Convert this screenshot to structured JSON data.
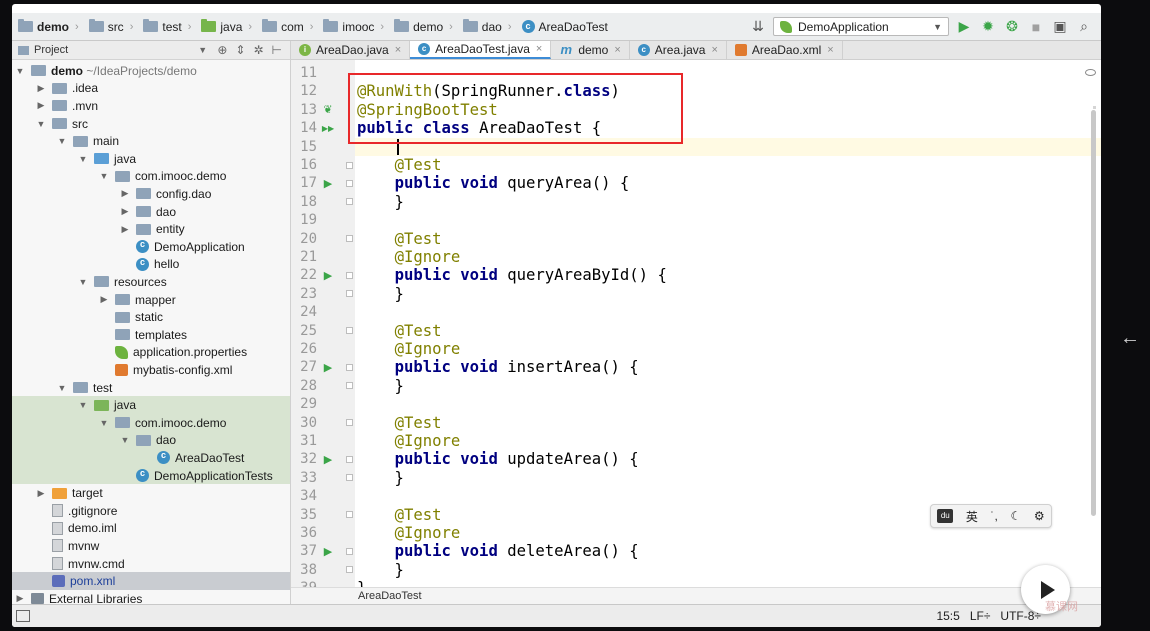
{
  "navbar": {
    "crumbs": [
      {
        "label": "demo",
        "icon": "folder-icon"
      },
      {
        "label": "src",
        "icon": "folder-icon"
      },
      {
        "label": "test",
        "icon": "folder-icon"
      },
      {
        "label": "java",
        "icon": "folder-green-icon"
      },
      {
        "label": "com",
        "icon": "package-icon"
      },
      {
        "label": "imooc",
        "icon": "package-icon"
      },
      {
        "label": "demo",
        "icon": "package-icon"
      },
      {
        "label": "dao",
        "icon": "package-icon"
      },
      {
        "label": "AreaDaoTest",
        "icon": "class-icon"
      }
    ],
    "run_config": "DemoApplication"
  },
  "project_panel": {
    "title": "Project",
    "tree": [
      {
        "label": "demo",
        "suffix": " ~/IdeaProjects/demo",
        "depth": 0,
        "arrow": "▼",
        "icon": "folder"
      },
      {
        "label": ".idea",
        "depth": 1,
        "arrow": "▶",
        "icon": "folder"
      },
      {
        "label": ".mvn",
        "depth": 1,
        "arrow": "▶",
        "icon": "folder"
      },
      {
        "label": "src",
        "depth": 1,
        "arrow": "▼",
        "icon": "folder"
      },
      {
        "label": "main",
        "depth": 2,
        "arrow": "▼",
        "icon": "folder"
      },
      {
        "label": "java",
        "depth": 3,
        "arrow": "▼",
        "icon": "folder-blue"
      },
      {
        "label": "com.imooc.demo",
        "depth": 4,
        "arrow": "▼",
        "icon": "pkg"
      },
      {
        "label": "config.dao",
        "depth": 5,
        "arrow": "▶",
        "icon": "pkg"
      },
      {
        "label": "dao",
        "depth": 5,
        "arrow": "▶",
        "icon": "pkg"
      },
      {
        "label": "entity",
        "depth": 5,
        "arrow": "▶",
        "icon": "pkg"
      },
      {
        "label": "DemoApplication",
        "depth": 5,
        "arrow": "",
        "icon": "cls"
      },
      {
        "label": "hello",
        "depth": 5,
        "arrow": "",
        "icon": "cls"
      },
      {
        "label": "resources",
        "depth": 3,
        "arrow": "▼",
        "icon": "folder-res"
      },
      {
        "label": "mapper",
        "depth": 4,
        "arrow": "▶",
        "icon": "folder"
      },
      {
        "label": "static",
        "depth": 4,
        "arrow": "",
        "icon": "folder"
      },
      {
        "label": "templates",
        "depth": 4,
        "arrow": "",
        "icon": "folder"
      },
      {
        "label": "application.properties",
        "depth": 4,
        "arrow": "",
        "icon": "props"
      },
      {
        "label": "mybatis-config.xml",
        "depth": 4,
        "arrow": "",
        "icon": "xml"
      },
      {
        "label": "test",
        "depth": 2,
        "arrow": "▼",
        "icon": "folder"
      },
      {
        "label": "java",
        "depth": 3,
        "arrow": "▼",
        "icon": "folder-green",
        "sel": true
      },
      {
        "label": "com.imooc.demo",
        "depth": 4,
        "arrow": "▼",
        "icon": "pkg",
        "sel": true
      },
      {
        "label": "dao",
        "depth": 5,
        "arrow": "▼",
        "icon": "pkg",
        "sel": true
      },
      {
        "label": "AreaDaoTest",
        "depth": 6,
        "arrow": "",
        "icon": "cls",
        "sel": true
      },
      {
        "label": "DemoApplicationTests",
        "depth": 5,
        "arrow": "",
        "icon": "cls",
        "sel": true
      },
      {
        "label": "target",
        "depth": 1,
        "arrow": "▶",
        "icon": "folder-orange"
      },
      {
        "label": ".gitignore",
        "depth": 1,
        "arrow": "",
        "icon": "file"
      },
      {
        "label": "demo.iml",
        "depth": 1,
        "arrow": "",
        "icon": "file"
      },
      {
        "label": "mvnw",
        "depth": 1,
        "arrow": "",
        "icon": "file"
      },
      {
        "label": "mvnw.cmd",
        "depth": 1,
        "arrow": "",
        "icon": "file"
      },
      {
        "label": "pom.xml",
        "depth": 1,
        "arrow": "",
        "icon": "pom",
        "hl": true
      },
      {
        "label": "External Libraries",
        "depth": 0,
        "arrow": "▶",
        "icon": "lib"
      }
    ]
  },
  "tabs": [
    {
      "label": "AreaDao.java",
      "icon": "i",
      "active": false
    },
    {
      "label": "AreaDaoTest.java",
      "icon": "c",
      "active": true
    },
    {
      "label": "demo",
      "icon": "m",
      "active": false
    },
    {
      "label": "Area.java",
      "icon": "c",
      "active": false
    },
    {
      "label": "AreaDao.xml",
      "icon": "x",
      "active": false
    }
  ],
  "editor": {
    "lines": [
      {
        "n": "11",
        "tokens": []
      },
      {
        "n": "12",
        "tokens": [
          [
            "ann",
            "@RunWith"
          ],
          [
            "",
            "(SpringRunner."
          ],
          [
            "kw",
            "class"
          ],
          [
            "",
            ")"
          ]
        ]
      },
      {
        "n": "13",
        "tokens": [
          [
            "ann",
            "@SpringBootTest"
          ]
        ],
        "gutter": "leaf"
      },
      {
        "n": "14",
        "tokens": [
          [
            "kw",
            "public class "
          ],
          [
            "",
            "AreaDaoTest {"
          ]
        ],
        "gutter": "run2"
      },
      {
        "n": "15",
        "tokens": [],
        "cur": true
      },
      {
        "n": "16",
        "tokens": [
          [
            "",
            "    "
          ],
          [
            "ann",
            "@Test"
          ]
        ],
        "fold": true
      },
      {
        "n": "17",
        "tokens": [
          [
            "",
            "    "
          ],
          [
            "kw",
            "public void "
          ],
          [
            "",
            "queryArea() {"
          ]
        ],
        "gutter": "run"
      },
      {
        "n": "18",
        "tokens": [
          [
            "",
            "    }"
          ]
        ],
        "fold": true
      },
      {
        "n": "19",
        "tokens": []
      },
      {
        "n": "20",
        "tokens": [
          [
            "",
            "    "
          ],
          [
            "ann",
            "@Test"
          ]
        ],
        "fold": true
      },
      {
        "n": "21",
        "tokens": [
          [
            "",
            "    "
          ],
          [
            "ann",
            "@Ignore"
          ]
        ]
      },
      {
        "n": "22",
        "tokens": [
          [
            "",
            "    "
          ],
          [
            "kw",
            "public void "
          ],
          [
            "",
            "queryAreaById() {"
          ]
        ],
        "gutter": "run"
      },
      {
        "n": "23",
        "tokens": [
          [
            "",
            "    }"
          ]
        ],
        "fold": true
      },
      {
        "n": "24",
        "tokens": []
      },
      {
        "n": "25",
        "tokens": [
          [
            "",
            "    "
          ],
          [
            "ann",
            "@Test"
          ]
        ],
        "fold": true
      },
      {
        "n": "26",
        "tokens": [
          [
            "",
            "    "
          ],
          [
            "ann",
            "@Ignore"
          ]
        ]
      },
      {
        "n": "27",
        "tokens": [
          [
            "",
            "    "
          ],
          [
            "kw",
            "public void "
          ],
          [
            "",
            "insertArea() {"
          ]
        ],
        "gutter": "run"
      },
      {
        "n": "28",
        "tokens": [
          [
            "",
            "    }"
          ]
        ],
        "fold": true
      },
      {
        "n": "29",
        "tokens": []
      },
      {
        "n": "30",
        "tokens": [
          [
            "",
            "    "
          ],
          [
            "ann",
            "@Test"
          ]
        ],
        "fold": true
      },
      {
        "n": "31",
        "tokens": [
          [
            "",
            "    "
          ],
          [
            "ann",
            "@Ignore"
          ]
        ]
      },
      {
        "n": "32",
        "tokens": [
          [
            "",
            "    "
          ],
          [
            "kw",
            "public void "
          ],
          [
            "",
            "updateArea() {"
          ]
        ],
        "gutter": "run"
      },
      {
        "n": "33",
        "tokens": [
          [
            "",
            "    }"
          ]
        ],
        "fold": true
      },
      {
        "n": "34",
        "tokens": []
      },
      {
        "n": "35",
        "tokens": [
          [
            "",
            "    "
          ],
          [
            "ann",
            "@Test"
          ]
        ],
        "fold": true
      },
      {
        "n": "36",
        "tokens": [
          [
            "",
            "    "
          ],
          [
            "ann",
            "@Ignore"
          ]
        ]
      },
      {
        "n": "37",
        "tokens": [
          [
            "",
            "    "
          ],
          [
            "kw",
            "public void "
          ],
          [
            "",
            "deleteArea() {"
          ]
        ],
        "gutter": "run"
      },
      {
        "n": "38",
        "tokens": [
          [
            "",
            "    }"
          ]
        ],
        "fold": true
      },
      {
        "n": "39",
        "tokens": [
          [
            "",
            "}"
          ]
        ]
      }
    ],
    "crumb": "AreaDaoTest"
  },
  "status": {
    "position": "15:5",
    "line_sep": "LF÷",
    "encoding": "UTF-8÷"
  },
  "ime": {
    "du": "du",
    "lang": "英",
    "punct": "˙,",
    "moon": "☾",
    "gear": "⚙"
  },
  "watermark": "慕课网",
  "colors": {
    "annotation": "#808000",
    "keyword": "#000080",
    "highlight_box": "#e8282a",
    "run_green": "#3ba548"
  }
}
